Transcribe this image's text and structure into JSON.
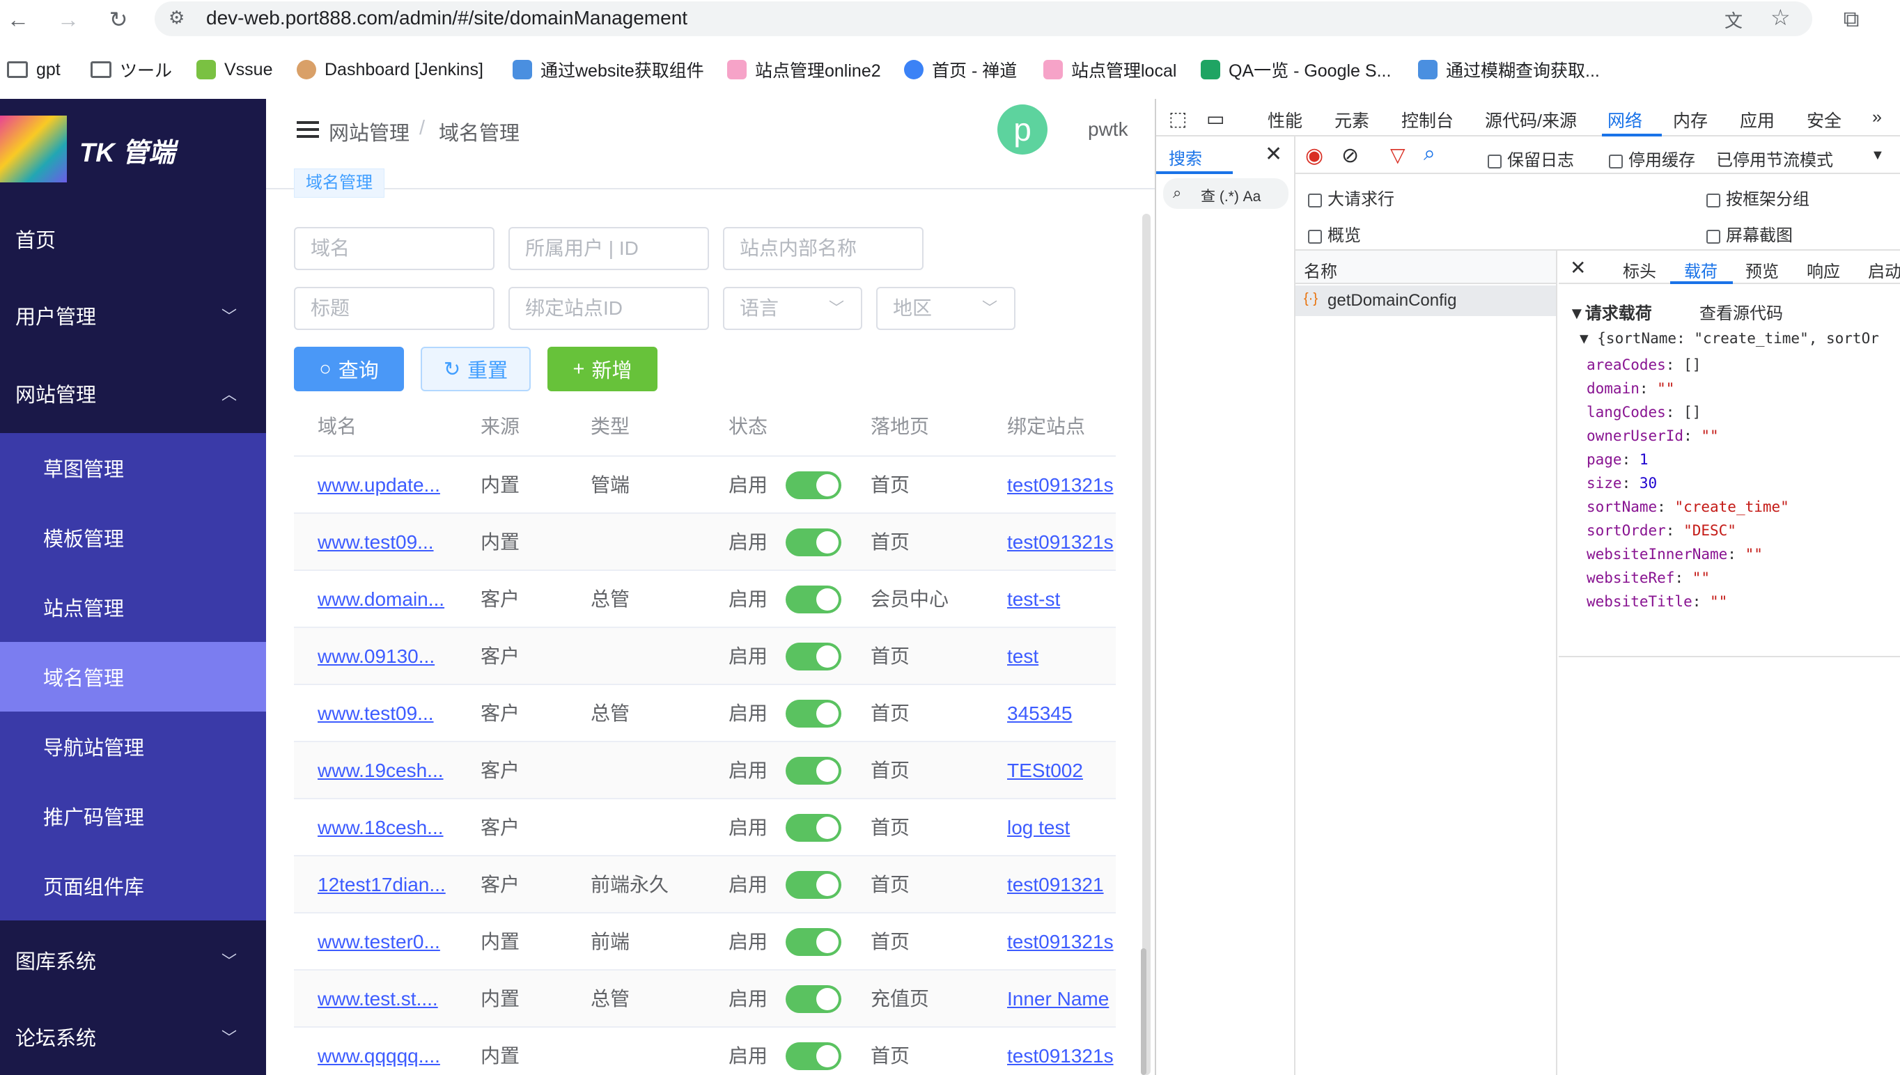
{
  "browser": {
    "url": "dev-web.port888.com/admin/#/site/domainManagement",
    "bookmarks": [
      "gpt",
      "ツール",
      "Vssue",
      "Dashboard [Jenkins]",
      "通过website获取组件",
      "站点管理online2",
      "首页 - 禅道",
      "站点管理local",
      "QA一览 - Google S...",
      "通过模糊查询获取..."
    ]
  },
  "sidebar": {
    "brand": "TK 管端",
    "items": [
      {
        "label": "首页"
      },
      {
        "label": "用户管理"
      },
      {
        "label": "网站管理"
      },
      {
        "label": "草图管理"
      },
      {
        "label": "模板管理"
      },
      {
        "label": "站点管理"
      },
      {
        "label": "域名管理"
      },
      {
        "label": "导航站管理"
      },
      {
        "label": "推广码管理"
      },
      {
        "label": "页面组件库"
      },
      {
        "label": "图库系统"
      },
      {
        "label": "论坛系统"
      }
    ]
  },
  "header": {
    "breadcrumb_1": "网站管理",
    "breadcrumb_sep": "/",
    "breadcrumb_2": "域名管理",
    "avatar_letter": "p",
    "username": "pwtk",
    "tag": "域名管理"
  },
  "filters": {
    "domain": "域名",
    "owner": "所属用户 | ID",
    "inner_name": "站点内部名称",
    "title": "标题",
    "site_id": "绑定站点ID",
    "language": "语言",
    "region": "地区"
  },
  "buttons": {
    "query": "查询",
    "reset": "重置",
    "add": "新增"
  },
  "table": {
    "headers": [
      "域名",
      "来源",
      "类型",
      "状态",
      "落地页",
      "绑定站点"
    ],
    "rows": [
      {
        "domain": "www.update...",
        "source": "内置",
        "type": "管端",
        "status": "启用",
        "landing": "首页",
        "site": "test091321s"
      },
      {
        "domain": "www.test09...",
        "source": "内置",
        "type": "",
        "status": "启用",
        "landing": "首页",
        "site": "test091321s"
      },
      {
        "domain": "www.domain...",
        "source": "客户",
        "type": "总管",
        "status": "启用",
        "landing": "会员中心",
        "site": "test-st"
      },
      {
        "domain": "www.09130...",
        "source": "客户",
        "type": "",
        "status": "启用",
        "landing": "首页",
        "site": "test"
      },
      {
        "domain": "www.test09...",
        "source": "客户",
        "type": "总管",
        "status": "启用",
        "landing": "首页",
        "site": "345345"
      },
      {
        "domain": "www.19cesh...",
        "source": "客户",
        "type": "",
        "status": "启用",
        "landing": "首页",
        "site": "TESt002"
      },
      {
        "domain": "www.18cesh...",
        "source": "客户",
        "type": "",
        "status": "启用",
        "landing": "首页",
        "site": "log test"
      },
      {
        "domain": "12test17dian...",
        "source": "客户",
        "type": "前端永久",
        "status": "启用",
        "landing": "首页",
        "site": "test091321"
      },
      {
        "domain": "www.tester0...",
        "source": "内置",
        "type": "前端",
        "status": "启用",
        "landing": "首页",
        "site": "test091321s"
      },
      {
        "domain": "www.test.st....",
        "source": "内置",
        "type": "总管",
        "status": "启用",
        "landing": "充值页",
        "site": "Inner Name"
      },
      {
        "domain": "www.qqqqq....",
        "source": "内置",
        "type": "",
        "status": "启用",
        "landing": "首页",
        "site": "test091321s"
      }
    ]
  },
  "devtools": {
    "tabs": [
      "性能",
      "元素",
      "控制台",
      "源代码/来源",
      "网络",
      "内存",
      "应用",
      "安全"
    ],
    "search_label": "搜索",
    "search_opts": "查 (.*) Aa",
    "preserve_log": "保留日志",
    "disable_cache": "停用缓存",
    "throttle": "已停用节流模式",
    "big_rows": "大请求行",
    "group_by_frame": "按框架分组",
    "overview": "概览",
    "screenshot": "屏幕截图",
    "name_header": "名称",
    "request_name": "getDomainConfig",
    "detail_tabs": [
      "标头",
      "载荷",
      "预览",
      "响应",
      "启动"
    ],
    "payload_title": "▼请求载荷",
    "view_source": "查看源代码",
    "summary": "▼ {sortName: \"create_time\", sortOr",
    "payload": [
      {
        "k": "areaCodes",
        "v": "[]"
      },
      {
        "k": "domain",
        "v": "\"\""
      },
      {
        "k": "langCodes",
        "v": "[]"
      },
      {
        "k": "ownerUserId",
        "v": "\"\""
      },
      {
        "k": "page",
        "v": "1"
      },
      {
        "k": "size",
        "v": "30"
      },
      {
        "k": "sortName",
        "v": "\"create_time\""
      },
      {
        "k": "sortOrder",
        "v": "\"DESC\""
      },
      {
        "k": "websiteInnerName",
        "v": "\"\""
      },
      {
        "k": "websiteRef",
        "v": "\"\""
      },
      {
        "k": "websiteTitle",
        "v": "\"\""
      }
    ]
  }
}
